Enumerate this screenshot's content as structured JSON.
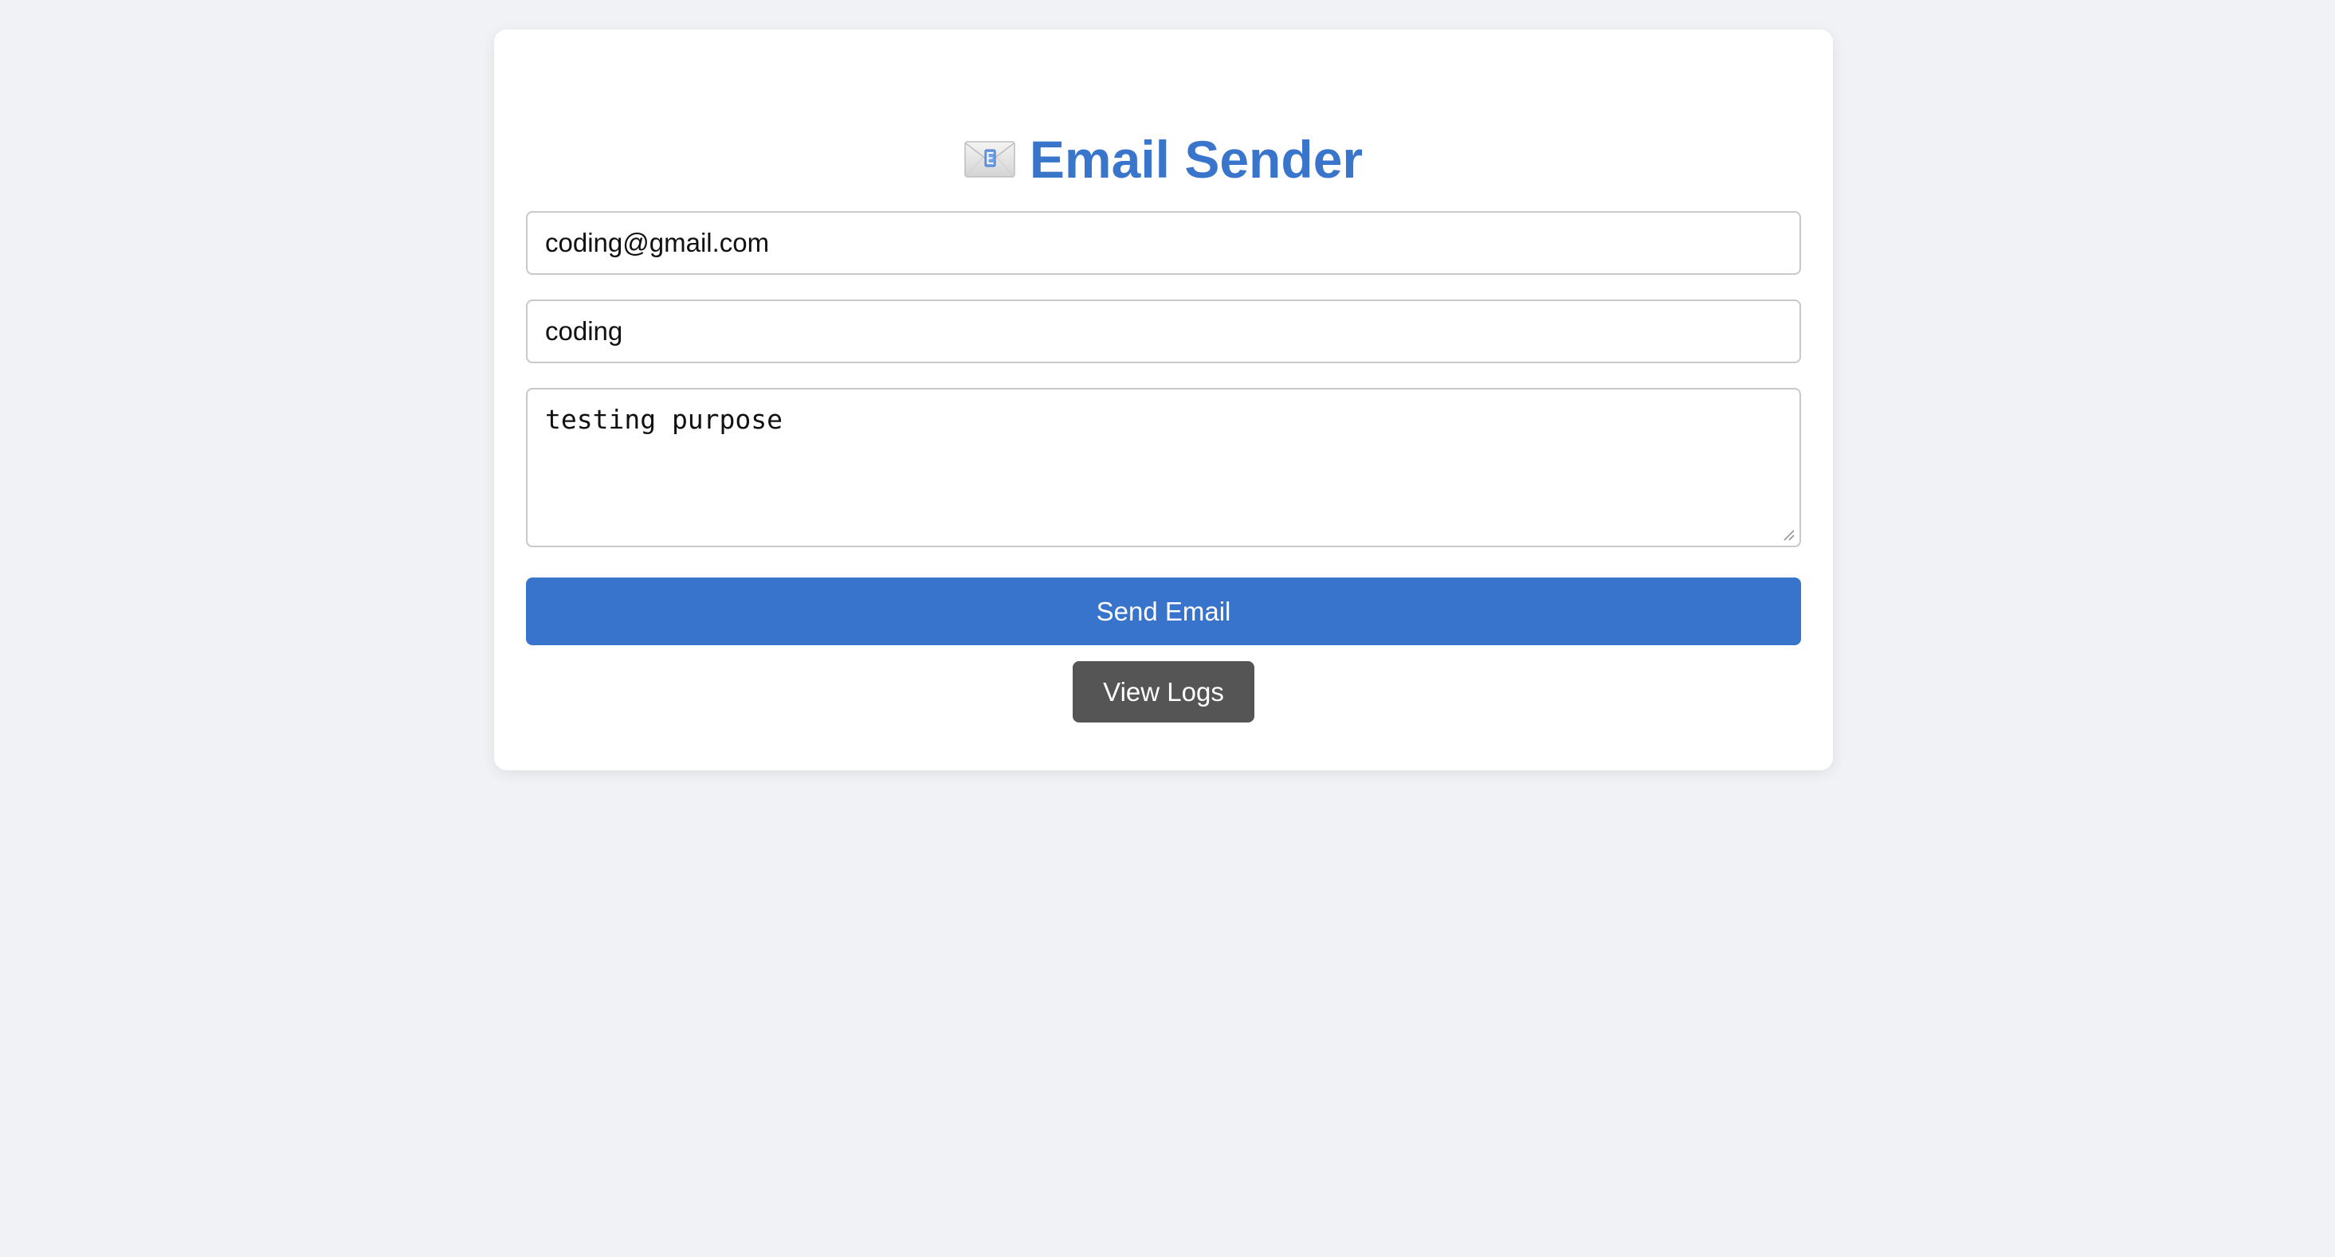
{
  "app": {
    "title": "Email Sender",
    "icon": "envelope-icon"
  },
  "form": {
    "to_value": "coding@gmail.com",
    "subject_value": "coding",
    "message_value": "testing purpose"
  },
  "actions": {
    "send_label": "Send Email",
    "logs_label": "View Logs"
  },
  "colors": {
    "background": "#f0f2f5",
    "title": "#3a75cc",
    "send_button": "#3874cb",
    "logs_button": "#555555"
  }
}
